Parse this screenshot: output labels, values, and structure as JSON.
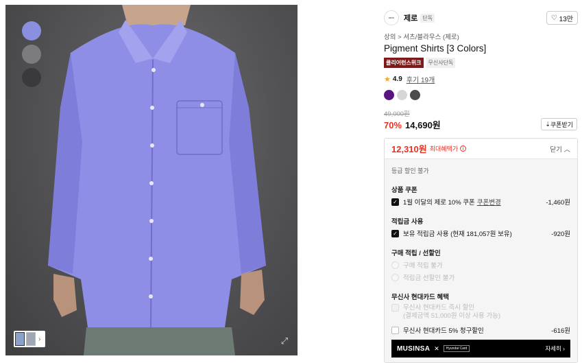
{
  "image": {
    "swatch_colors": [
      "#8a8fe0",
      "#7c7c7f",
      "#3a3a3c"
    ],
    "expand_icon": "expand-icon"
  },
  "brand": {
    "logo_text": "ZERO",
    "name": "제로",
    "badge": "단독",
    "likes": "13만"
  },
  "breadcrumb": "상의 > 셔츠/블라우스 (제로)",
  "product_title": "Pigment Shirts [3 Colors]",
  "tags": [
    "클리어런스위크",
    "무신사단독"
  ],
  "rating": {
    "value": "4.9",
    "reviews": "후기 19개"
  },
  "colors": [
    "#5a1480",
    "#d6d6d6",
    "#4c4c4e"
  ],
  "price": {
    "original": "49,000원",
    "discount": "70%",
    "sale": "14,690원",
    "coupon_button": "쿠폰받기"
  },
  "benefit": {
    "max_price": "12,310원",
    "max_label": "최대혜택가",
    "close_label": "닫기",
    "grade_note": "등급 할인 불가",
    "product_coupon_title": "상품 쿠폰",
    "coupon_row": {
      "text": "1월 이달의 제로 10% 쿠폰",
      "link": "쿠폰변경",
      "amount": "-1,460원"
    },
    "points_title": "적립금 사용",
    "points_row": {
      "text": "보유 적립금 사용 (현재 181,057원 보유)",
      "amount": "-920원"
    },
    "purchase_title": "구매 적립 / 선할인",
    "purchase_opts": [
      "구매 적립 불가",
      "적립금 선할인 불가"
    ],
    "card_title": "무신사 현대카드 혜택",
    "card_row1": {
      "text": "무신사 현대카드 즉시 할인",
      "sub": "(결제금액 51,000원 이상 사용 가능)"
    },
    "card_row2": {
      "text": "무신사 현대카드 5% 청구할인",
      "amount": "-616원"
    },
    "card_banner": {
      "brand": "MUSINSA",
      "partner": "Hyundai Card",
      "more": "자세히"
    }
  }
}
